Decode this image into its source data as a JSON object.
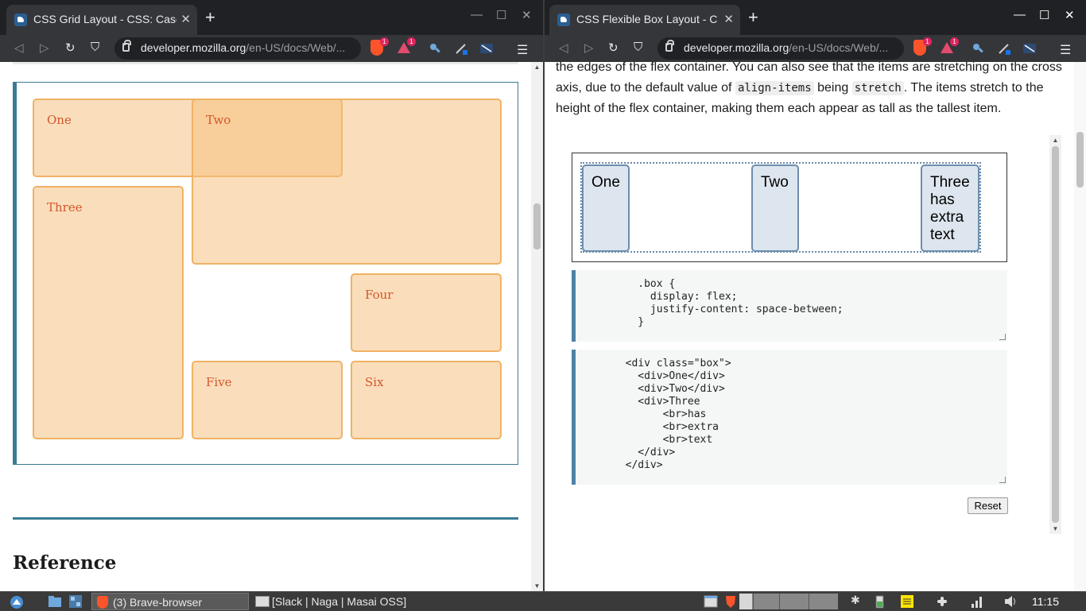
{
  "left_window": {
    "tab_title": "CSS Grid Layout - CSS: Casca",
    "url_host": "developer.mozilla.org",
    "url_path": "/en-US/docs/Web/...",
    "shield_badge": "1",
    "rewards_badge": "1",
    "grid_items": [
      "One",
      "Two",
      "Three",
      "Four",
      "Five",
      "Six"
    ],
    "heading": "Reference"
  },
  "right_window": {
    "tab_title": "CSS Flexible Box Layout - C",
    "url_host": "developer.mozilla.org",
    "url_path": "/en-US/docs/Web/...",
    "shield_badge": "1",
    "rewards_badge": "1",
    "para_1": "the edges of the flex container. You can also see that the items are stretching on the cross axis, due to the default value of ",
    "code_1": "align-items",
    "para_2": " being ",
    "code_2": "stretch",
    "para_3": ". The items stretch to the height of the flex container, making them each appear as tall as the tallest item.",
    "flex_items": [
      "One",
      "Two",
      "Three\nhas\nextra\ntext"
    ],
    "css_code": "          .box {\n            display: flex;\n            justify-content: space-between;\n          }",
    "html_code": "        <div class=\"box\">\n          <div>One</div>\n          <div>Two</div>\n          <div>Three\n              <br>has\n              <br>extra\n              <br>text\n          </div>\n        </div>",
    "reset_label": "Reset"
  },
  "taskbar": {
    "item_1": "(3) Brave-browser",
    "item_2": "[Slack | Naga | Masai OSS]",
    "clock": "11:15"
  },
  "icons": {
    "new_tab": "+",
    "tab_close": "✕",
    "minimize": "—",
    "maximize": "☐",
    "close": "✕",
    "back": "◁",
    "forward": "▷",
    "reload": "↻",
    "bookmark": "⛉",
    "menu": "☰"
  },
  "colors": {
    "mdn_accent": "#3a7b94",
    "grid_item_border": "#f0b265",
    "grid_item_text": "#d4572a",
    "brave_orange": "#fb542b"
  }
}
